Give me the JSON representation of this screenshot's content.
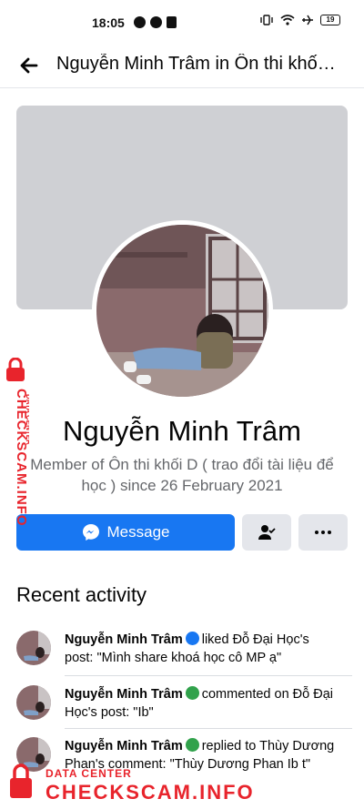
{
  "status_bar": {
    "time": "18:05",
    "battery": "19",
    "icons": [
      "messenger-icon",
      "cloud-icon",
      "note-icon",
      "vibrate-icon",
      "wifi-icon",
      "airplane-icon",
      "battery-icon"
    ]
  },
  "header": {
    "title": "Nguyễn Minh Trâm in Ôn thi khố…"
  },
  "profile": {
    "name": "Nguyễn Minh Trâm",
    "membership": "Member of Ôn thi khối D ( trao đổi tài liệu để học ) since 26 February 2021"
  },
  "actions": {
    "message_label": "Message"
  },
  "recent": {
    "title": "Recent activity",
    "items": [
      {
        "name": "Nguyễn Minh Trâm",
        "type": "like",
        "text": "liked Đỗ Đại Học's post: \"Mình share khoá học cô MP ạ\""
      },
      {
        "name": "Nguyễn Minh Trâm",
        "type": "comment",
        "text": "commented on Đỗ Đại Học's post: \"Ib\""
      },
      {
        "name": "Nguyễn Minh Trâm",
        "type": "comment",
        "text": "replied to Thùy Dương Phan's comment: \"Thùy Dương Phan Ib t\""
      }
    ]
  },
  "watermark": {
    "small": "DATA CENTER",
    "big": "CHECKSCAM.INFO"
  },
  "colors": {
    "primary": "#1877f2",
    "like_badge": "#1877f2",
    "comment_badge": "#31a24c",
    "watermark": "#e8242c",
    "cover": "#cfd0d4"
  }
}
